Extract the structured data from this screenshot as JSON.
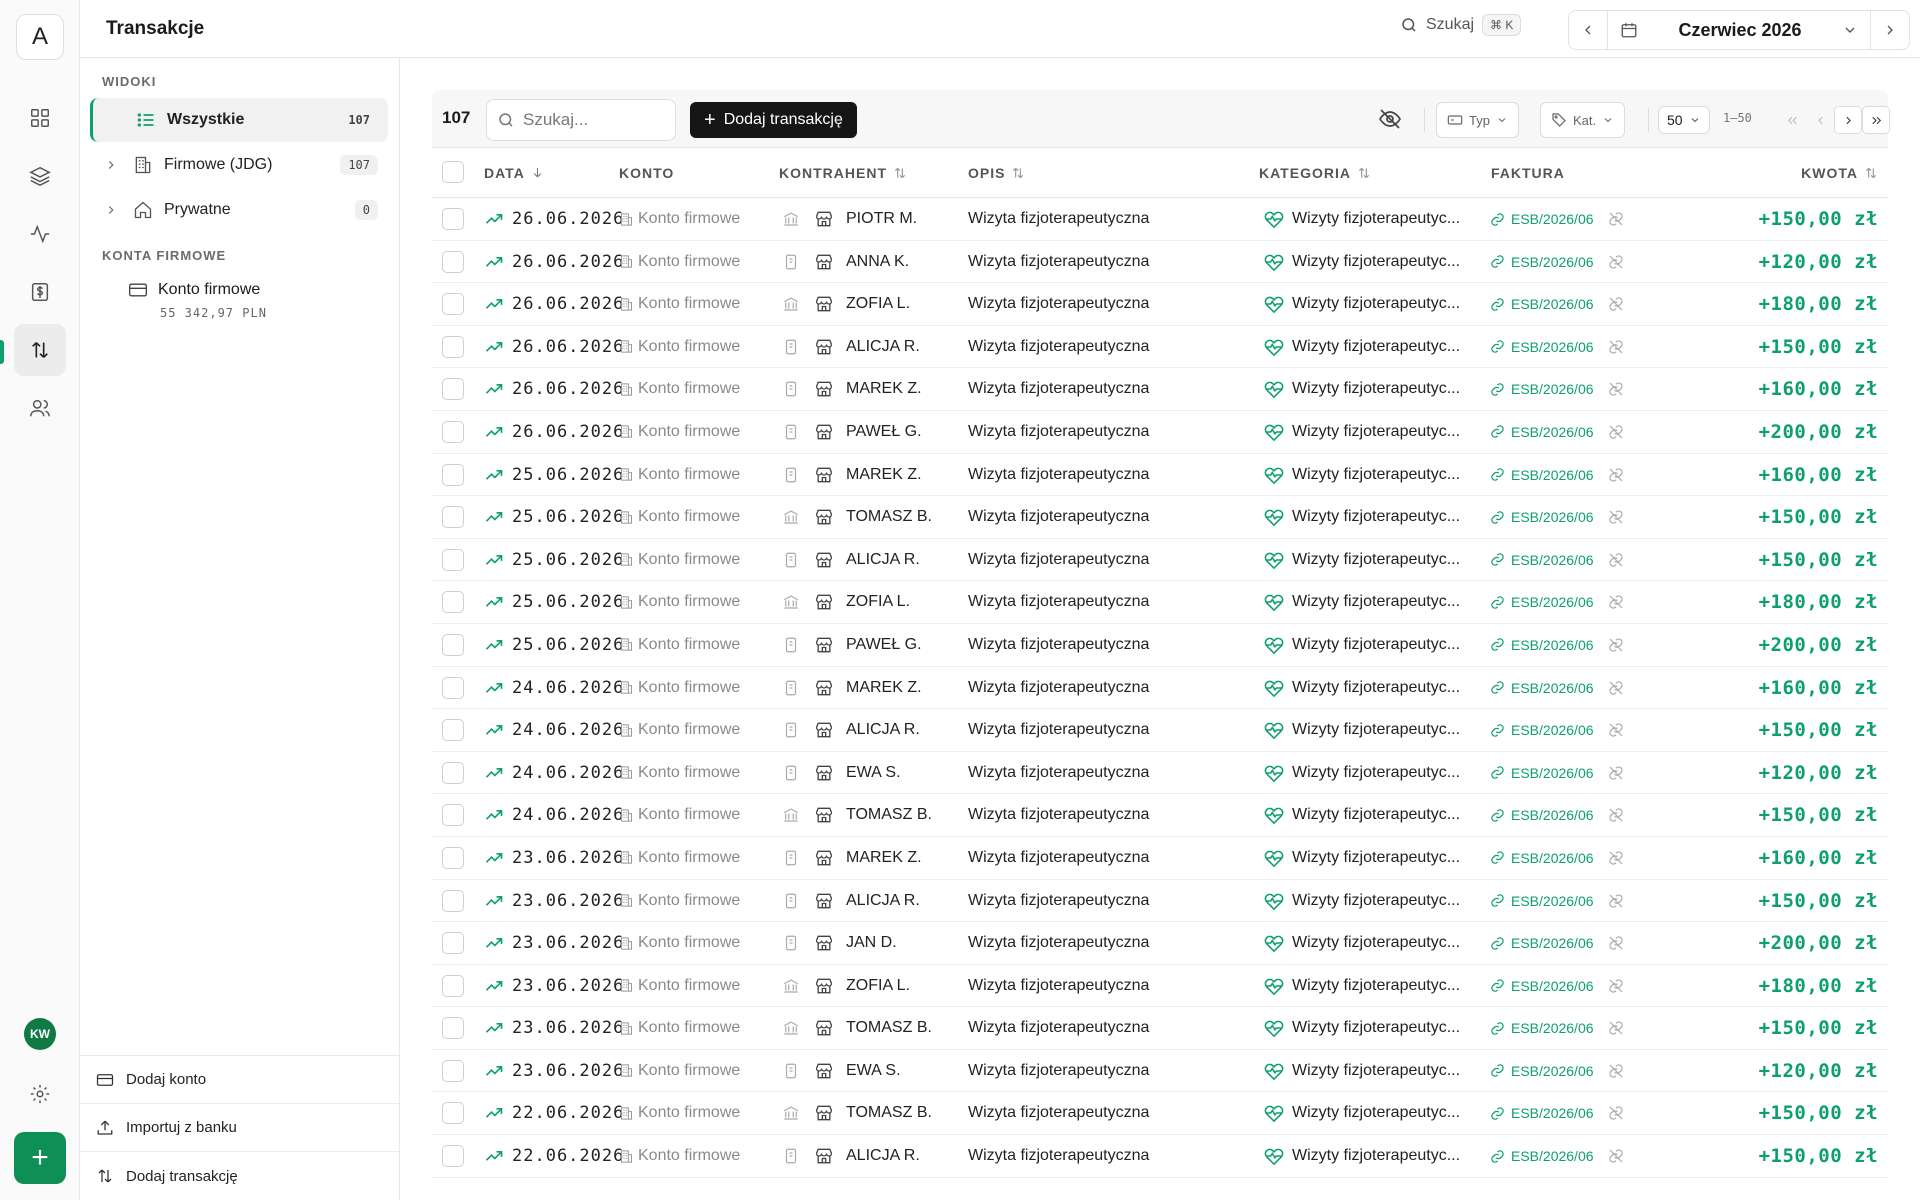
{
  "app": {
    "logo_letter": "A"
  },
  "header": {
    "title": "Transakcje",
    "search_label": "Szukaj",
    "search_shortcut": "⌘ K",
    "month": "Czerwiec 2026"
  },
  "user": {
    "initials": "KW"
  },
  "sidebar": {
    "views_label": "WIDOKI",
    "views": [
      {
        "label": "Wszystkie",
        "count": "107"
      },
      {
        "label": "Firmowe (JDG)",
        "count": "107"
      },
      {
        "label": "Prywatne",
        "count": "0"
      }
    ],
    "accounts_label": "KONTA FIRMOWE",
    "account": {
      "name": "Konto firmowe",
      "balance": "55 342,97 PLN"
    },
    "actions": [
      "Dodaj konto",
      "Importuj z banku",
      "Dodaj transakcję"
    ]
  },
  "toolbar": {
    "count": "107",
    "search_placeholder": "Szukaj...",
    "add_label": "Dodaj transakcję",
    "type_filter": "Typ",
    "category_filter": "Kat.",
    "per_page": "50",
    "range": "1–50"
  },
  "table": {
    "columns": [
      "DATA",
      "KONTO",
      "KONTRAHENT",
      "OPIS",
      "KATEGORIA",
      "FAKTURA",
      "KWOTA"
    ],
    "rows": [
      {
        "date": "26.06.2026",
        "account": "Konto firmowe",
        "bank": "bank",
        "contractor": "PIOTR M.",
        "description": "Wizyta fizjoterapeutyczna",
        "category": "Wizyty fizjoterapeutyc...",
        "invoice": "ESB/2026/06",
        "amount": "+150,00 zł"
      },
      {
        "date": "26.06.2026",
        "account": "Konto firmowe",
        "bank": "doc",
        "contractor": "ANNA K.",
        "description": "Wizyta fizjoterapeutyczna",
        "category": "Wizyty fizjoterapeutyc...",
        "invoice": "ESB/2026/06",
        "amount": "+120,00 zł"
      },
      {
        "date": "26.06.2026",
        "account": "Konto firmowe",
        "bank": "bank",
        "contractor": "ZOFIA L.",
        "description": "Wizyta fizjoterapeutyczna",
        "category": "Wizyty fizjoterapeutyc...",
        "invoice": "ESB/2026/06",
        "amount": "+180,00 zł"
      },
      {
        "date": "26.06.2026",
        "account": "Konto firmowe",
        "bank": "doc",
        "contractor": "ALICJA R.",
        "description": "Wizyta fizjoterapeutyczna",
        "category": "Wizyty fizjoterapeutyc...",
        "invoice": "ESB/2026/06",
        "amount": "+150,00 zł"
      },
      {
        "date": "26.06.2026",
        "account": "Konto firmowe",
        "bank": "doc",
        "contractor": "MAREK Z.",
        "description": "Wizyta fizjoterapeutyczna",
        "category": "Wizyty fizjoterapeutyc...",
        "invoice": "ESB/2026/06",
        "amount": "+160,00 zł"
      },
      {
        "date": "26.06.2026",
        "account": "Konto firmowe",
        "bank": "doc",
        "contractor": "PAWEŁ G.",
        "description": "Wizyta fizjoterapeutyczna",
        "category": "Wizyty fizjoterapeutyc...",
        "invoice": "ESB/2026/06",
        "amount": "+200,00 zł"
      },
      {
        "date": "25.06.2026",
        "account": "Konto firmowe",
        "bank": "doc",
        "contractor": "MAREK Z.",
        "description": "Wizyta fizjoterapeutyczna",
        "category": "Wizyty fizjoterapeutyc...",
        "invoice": "ESB/2026/06",
        "amount": "+160,00 zł"
      },
      {
        "date": "25.06.2026",
        "account": "Konto firmowe",
        "bank": "bank",
        "contractor": "TOMASZ B.",
        "description": "Wizyta fizjoterapeutyczna",
        "category": "Wizyty fizjoterapeutyc...",
        "invoice": "ESB/2026/06",
        "amount": "+150,00 zł"
      },
      {
        "date": "25.06.2026",
        "account": "Konto firmowe",
        "bank": "doc",
        "contractor": "ALICJA R.",
        "description": "Wizyta fizjoterapeutyczna",
        "category": "Wizyty fizjoterapeutyc...",
        "invoice": "ESB/2026/06",
        "amount": "+150,00 zł"
      },
      {
        "date": "25.06.2026",
        "account": "Konto firmowe",
        "bank": "bank",
        "contractor": "ZOFIA L.",
        "description": "Wizyta fizjoterapeutyczna",
        "category": "Wizyty fizjoterapeutyc...",
        "invoice": "ESB/2026/06",
        "amount": "+180,00 zł"
      },
      {
        "date": "25.06.2026",
        "account": "Konto firmowe",
        "bank": "doc",
        "contractor": "PAWEŁ G.",
        "description": "Wizyta fizjoterapeutyczna",
        "category": "Wizyty fizjoterapeutyc...",
        "invoice": "ESB/2026/06",
        "amount": "+200,00 zł"
      },
      {
        "date": "24.06.2026",
        "account": "Konto firmowe",
        "bank": "doc",
        "contractor": "MAREK Z.",
        "description": "Wizyta fizjoterapeutyczna",
        "category": "Wizyty fizjoterapeutyc...",
        "invoice": "ESB/2026/06",
        "amount": "+160,00 zł"
      },
      {
        "date": "24.06.2026",
        "account": "Konto firmowe",
        "bank": "doc",
        "contractor": "ALICJA R.",
        "description": "Wizyta fizjoterapeutyczna",
        "category": "Wizyty fizjoterapeutyc...",
        "invoice": "ESB/2026/06",
        "amount": "+150,00 zł"
      },
      {
        "date": "24.06.2026",
        "account": "Konto firmowe",
        "bank": "doc",
        "contractor": "EWA S.",
        "description": "Wizyta fizjoterapeutyczna",
        "category": "Wizyty fizjoterapeutyc...",
        "invoice": "ESB/2026/06",
        "amount": "+120,00 zł"
      },
      {
        "date": "24.06.2026",
        "account": "Konto firmowe",
        "bank": "bank",
        "contractor": "TOMASZ B.",
        "description": "Wizyta fizjoterapeutyczna",
        "category": "Wizyty fizjoterapeutyc...",
        "invoice": "ESB/2026/06",
        "amount": "+150,00 zł"
      },
      {
        "date": "23.06.2026",
        "account": "Konto firmowe",
        "bank": "doc",
        "contractor": "MAREK Z.",
        "description": "Wizyta fizjoterapeutyczna",
        "category": "Wizyty fizjoterapeutyc...",
        "invoice": "ESB/2026/06",
        "amount": "+160,00 zł"
      },
      {
        "date": "23.06.2026",
        "account": "Konto firmowe",
        "bank": "doc",
        "contractor": "ALICJA R.",
        "description": "Wizyta fizjoterapeutyczna",
        "category": "Wizyty fizjoterapeutyc...",
        "invoice": "ESB/2026/06",
        "amount": "+150,00 zł"
      },
      {
        "date": "23.06.2026",
        "account": "Konto firmowe",
        "bank": "doc",
        "contractor": "JAN D.",
        "description": "Wizyta fizjoterapeutyczna",
        "category": "Wizyty fizjoterapeutyc...",
        "invoice": "ESB/2026/06",
        "amount": "+200,00 zł"
      },
      {
        "date": "23.06.2026",
        "account": "Konto firmowe",
        "bank": "bank",
        "contractor": "ZOFIA L.",
        "description": "Wizyta fizjoterapeutyczna",
        "category": "Wizyty fizjoterapeutyc...",
        "invoice": "ESB/2026/06",
        "amount": "+180,00 zł"
      },
      {
        "date": "23.06.2026",
        "account": "Konto firmowe",
        "bank": "bank",
        "contractor": "TOMASZ B.",
        "description": "Wizyta fizjoterapeutyczna",
        "category": "Wizyty fizjoterapeutyc...",
        "invoice": "ESB/2026/06",
        "amount": "+150,00 zł"
      },
      {
        "date": "23.06.2026",
        "account": "Konto firmowe",
        "bank": "doc",
        "contractor": "EWA S.",
        "description": "Wizyta fizjoterapeutyczna",
        "category": "Wizyty fizjoterapeutyc...",
        "invoice": "ESB/2026/06",
        "amount": "+120,00 zł"
      },
      {
        "date": "22.06.2026",
        "account": "Konto firmowe",
        "bank": "bank",
        "contractor": "TOMASZ B.",
        "description": "Wizyta fizjoterapeutyczna",
        "category": "Wizyty fizjoterapeutyc...",
        "invoice": "ESB/2026/06",
        "amount": "+150,00 zł"
      },
      {
        "date": "22.06.2026",
        "account": "Konto firmowe",
        "bank": "doc",
        "contractor": "ALICJA R.",
        "description": "Wizyta fizjoterapeutyczna",
        "category": "Wizyty fizjoterapeutyc...",
        "invoice": "ESB/2026/06",
        "amount": "+150,00 zł"
      }
    ]
  },
  "colors": {
    "accent": "#0e9f6e",
    "primary_button": "#161616",
    "rail_plus": "#0d8f55"
  }
}
